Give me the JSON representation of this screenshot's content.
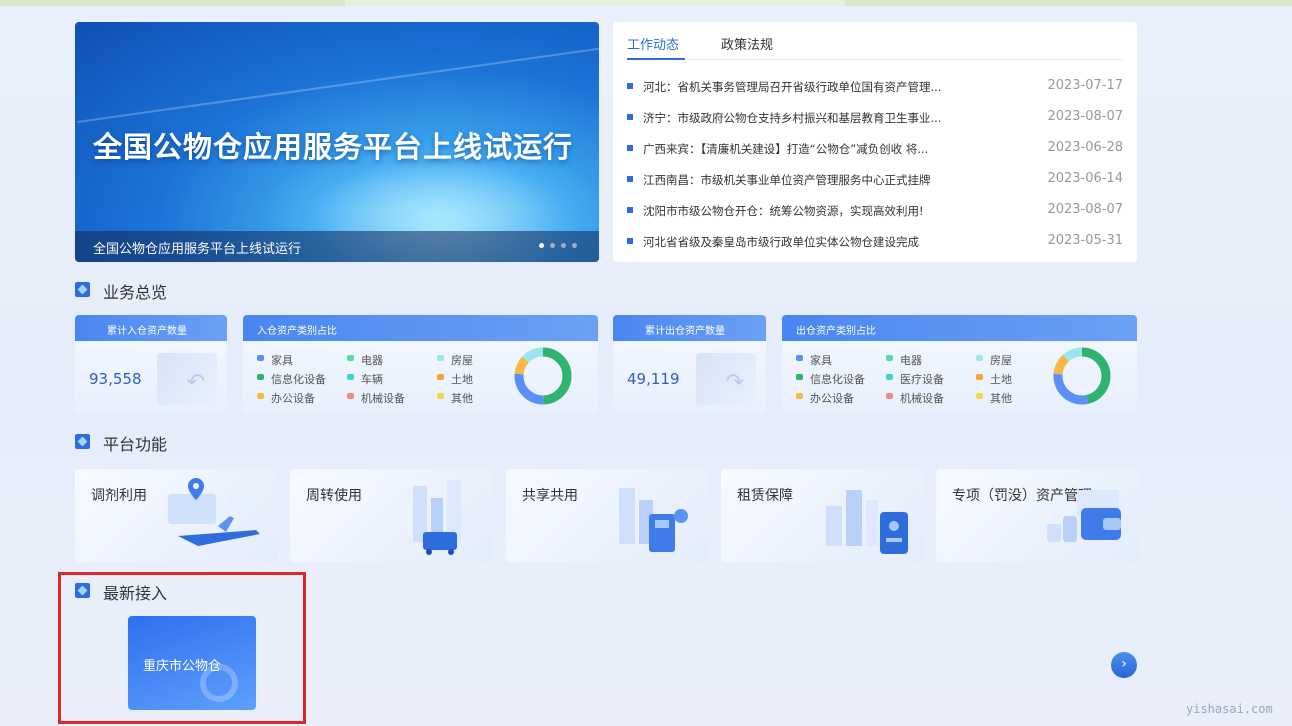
{
  "banner": {
    "title": "全国公物仓应用服务平台上线试运行",
    "caption": "全国公物仓应用服务平台上线试运行",
    "slides": 4,
    "active_slide": 1
  },
  "news": {
    "tabs": [
      {
        "label": "工作动态",
        "active": true
      },
      {
        "label": "政策法规",
        "active": false
      }
    ],
    "items": [
      {
        "title": "河北：省机关事务管理局召开省级行政单位国有资产管理...",
        "date": "2023-07-17"
      },
      {
        "title": "济宁：市级政府公物仓支持乡村振兴和基层教育卫生事业...",
        "date": "2023-08-07"
      },
      {
        "title": "广西来宾：【清廉机关建设】打造“公物仓”减负创收 将...",
        "date": "2023-06-28"
      },
      {
        "title": "江西南昌：市级机关事业单位资产管理服务中心正式挂牌",
        "date": "2023-06-14"
      },
      {
        "title": "沈阳市市级公物仓开仓：统筹公物资源，实现高效利用!",
        "date": "2023-08-07"
      },
      {
        "title": "河北省省级及秦皇岛市级行政单位实体公物仓建设完成",
        "date": "2023-05-31"
      }
    ]
  },
  "overview": {
    "section_title": "业务总览",
    "inbound_total": {
      "label": "累计入仓资产数量",
      "value": "93,558"
    },
    "inbound_types": {
      "label": "入仓资产类别占比",
      "legend": [
        {
          "name": "家具",
          "color": "#5b8ff9"
        },
        {
          "name": "电器",
          "color": "#5ad8a6"
        },
        {
          "name": "房屋",
          "color": "#9be5f0"
        },
        {
          "name": "信息化设备",
          "color": "#2fb36e"
        },
        {
          "name": "车辆",
          "color": "#3ed6c6"
        },
        {
          "name": "土地",
          "color": "#f6a33b"
        },
        {
          "name": "办公设备",
          "color": "#f7b84a"
        },
        {
          "name": "机械设备",
          "color": "#f08a7a"
        },
        {
          "name": "其他",
          "color": "#f3d64c"
        }
      ]
    },
    "outbound_total": {
      "label": "累计出仓资产数量",
      "value": "49,119"
    },
    "outbound_types": {
      "label": "出仓资产类别占比",
      "legend": [
        {
          "name": "家具",
          "color": "#5b8ff9"
        },
        {
          "name": "电器",
          "color": "#5ad8a6"
        },
        {
          "name": "房屋",
          "color": "#9be5f0"
        },
        {
          "name": "信息化设备",
          "color": "#2fb36e"
        },
        {
          "name": "医疗设备",
          "color": "#3ed6c6"
        },
        {
          "name": "土地",
          "color": "#f6a33b"
        },
        {
          "name": "办公设备",
          "color": "#f7b84a"
        },
        {
          "name": "机械设备",
          "color": "#f08a7a"
        },
        {
          "name": "其他",
          "color": "#f3d64c"
        }
      ]
    }
  },
  "functions": {
    "section_title": "平台功能",
    "items": [
      {
        "label": "调剂利用",
        "icon": "map-pin-plane-icon"
      },
      {
        "label": "周转使用",
        "icon": "city-cart-icon"
      },
      {
        "label": "共享共用",
        "icon": "building-phone-icon"
      },
      {
        "label": "租赁保障",
        "icon": "building-card-icon"
      },
      {
        "label": "专项（罚没）资产管理",
        "icon": "wallet-icon"
      }
    ]
  },
  "newest": {
    "section_title": "最新接入",
    "items": [
      {
        "label": "重庆市公物仓"
      }
    ]
  },
  "watermark": "yishasai.com",
  "colors": {
    "accent": "#2b6de0",
    "highlight_border": "#e0252d"
  }
}
